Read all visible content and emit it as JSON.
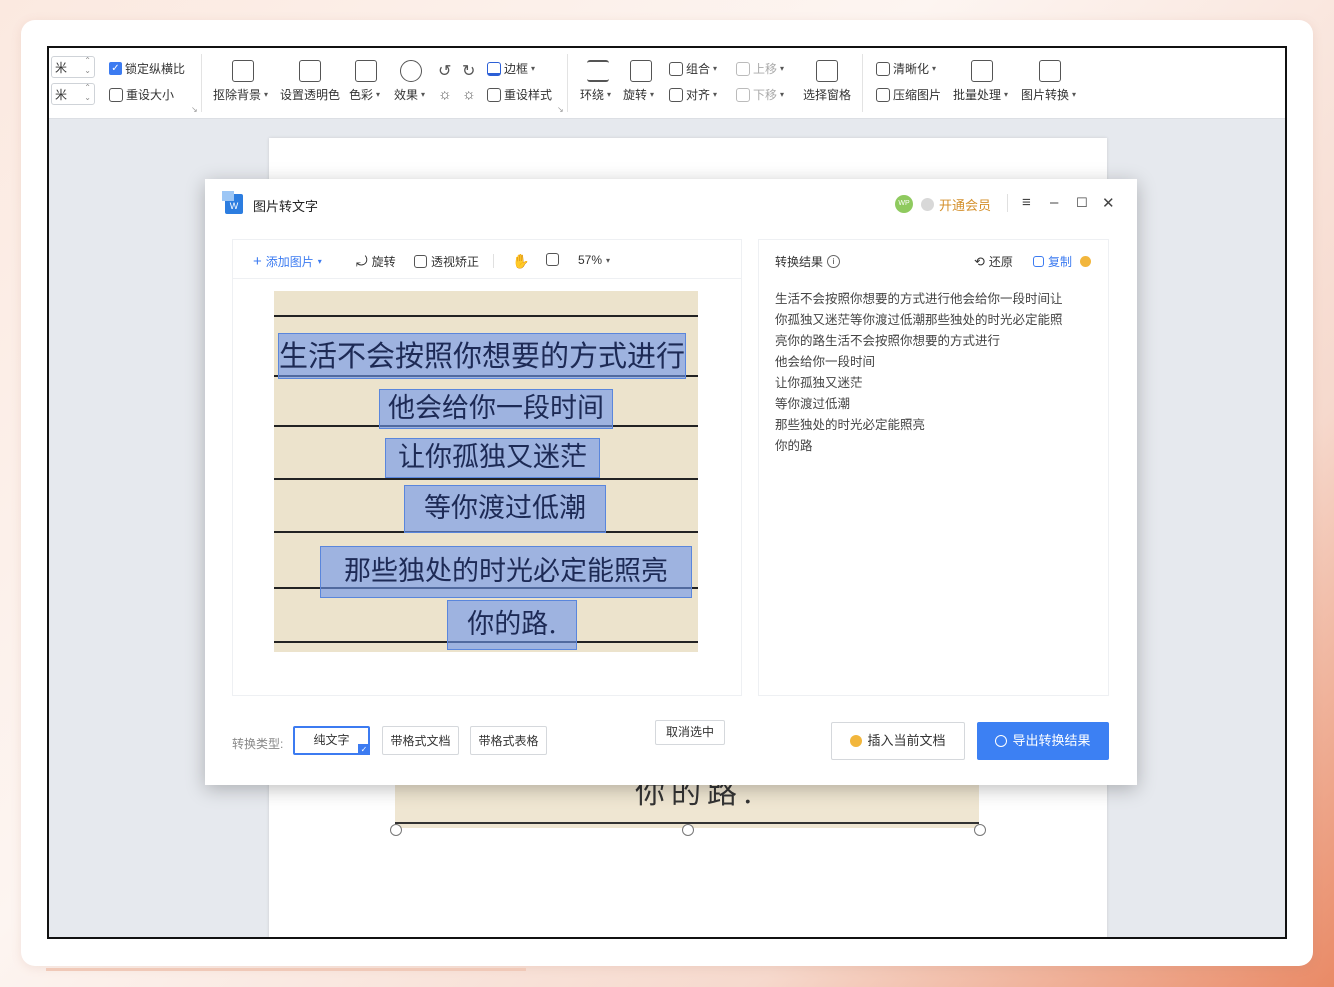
{
  "ribbon": {
    "unit_w": "米",
    "unit_h": "米",
    "lock_ratio": "锁定纵横比",
    "reset_size": "重设大小",
    "remove_bg": "抠除背景",
    "set_transparent": "设置透明色",
    "color": "色彩",
    "effects": "效果",
    "border": "边框",
    "reset_style": "重设样式",
    "wrap": "环绕",
    "rotate": "旋转",
    "group": "组合",
    "align": "对齐",
    "move_up": "上移",
    "move_down": "下移",
    "selection_pane": "选择窗格",
    "sharpen": "清晰化",
    "compress": "压缩图片",
    "batch": "批量处理",
    "convert": "图片转换"
  },
  "dialog": {
    "title": "图片转文字",
    "avatar": "WP",
    "vip": "开通会员",
    "left_toolbar": {
      "add_image": "添加图片",
      "rotate": "旋转",
      "perspective": "透视矫正",
      "zoom": "57%"
    },
    "photo_lines": [
      "生活不会按照你想要的方式进行",
      "他会给你一段时间",
      "让你孤独又迷茫",
      "等你渡过低潮",
      "那些独处的时光必定能照亮",
      "你的路."
    ],
    "cancel_selection": "取消选中",
    "result_title": "转换结果",
    "restore": "还原",
    "copy": "复制",
    "results": [
      "生活不会按照你想要的方式进行他会给你一段时间让",
      "你孤独又迷茫等你渡过低潮那些独处的时光必定能照",
      "亮你的路生活不会按照你想要的方式进行",
      "他会给你一段时间",
      "让你孤独又迷茫",
      "等你渡过低潮",
      "那些独处的时光必定能照亮",
      "你的路"
    ],
    "type_label": "转换类型:",
    "type_plain": "纯文字",
    "type_doc": "带格式文档",
    "type_table": "带格式表格",
    "insert": "插入当前文档",
    "export": "导出转换结果"
  },
  "document": {
    "image_text": "你的路."
  },
  "colors": {
    "accent": "#3c80f3",
    "vip": "#d4902c",
    "highlight": "#6e96eb"
  }
}
